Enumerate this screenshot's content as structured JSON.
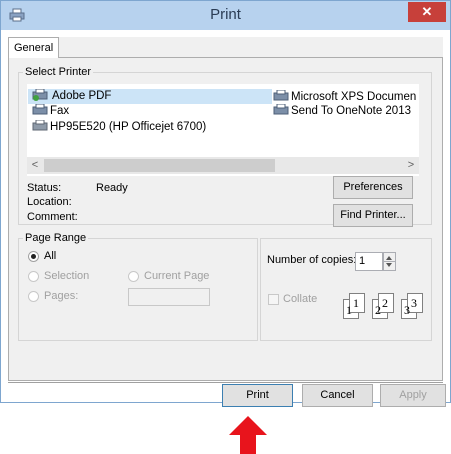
{
  "window": {
    "title": "Print",
    "close_glyph": "✕",
    "accent_color": "#c7403a",
    "titlebar_color": "#b7d2ee"
  },
  "tabs": [
    {
      "label": "General"
    }
  ],
  "select_printer": {
    "legend": "Select Printer",
    "printers": [
      {
        "name": "Adobe PDF",
        "icon": "pdf-printer-icon",
        "selected": true
      },
      {
        "name": "Fax",
        "icon": "fax-printer-icon",
        "selected": false
      },
      {
        "name": "HP95E520 (HP Officejet 6700)",
        "icon": "printer-icon",
        "selected": false
      },
      {
        "name": "Microsoft XPS Documen",
        "icon": "printer-icon",
        "selected": false
      },
      {
        "name": "Send To OneNote 2013",
        "icon": "printer-icon",
        "selected": false
      }
    ],
    "scroll_left": "<",
    "scroll_right": ">",
    "status_label": "Status:",
    "status_value": "Ready",
    "location_label": "Location:",
    "comment_label": "Comment:",
    "preferences_button": "Preferences",
    "find_printer_button": "Find Printer..."
  },
  "page_range": {
    "legend": "Page Range",
    "options": {
      "all": "All",
      "selection": "Selection",
      "current_page": "Current Page",
      "pages": "Pages:"
    },
    "selected": "All"
  },
  "copies": {
    "label": "Number of copies:",
    "value": "1",
    "collate_label": "Collate",
    "collate_checked": false,
    "collate_sets": [
      "1",
      "2",
      "3"
    ]
  },
  "footer": {
    "print_button": "Print",
    "cancel_button": "Cancel",
    "apply_button": "Apply"
  },
  "annotation": {
    "arrow_color": "#e8141c"
  }
}
